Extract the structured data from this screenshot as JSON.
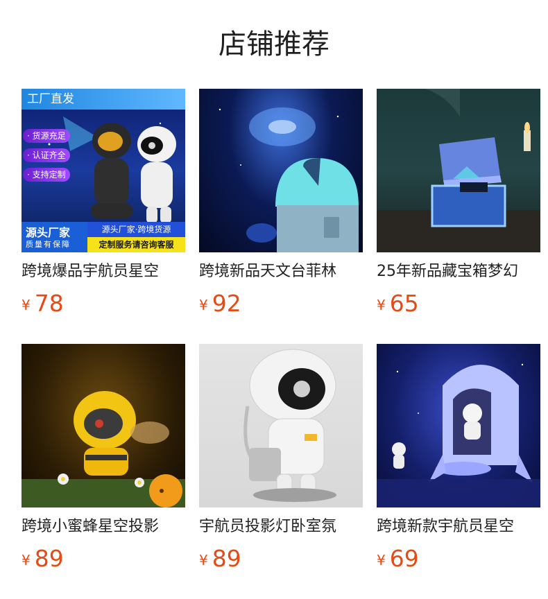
{
  "section": {
    "title": "店铺推荐"
  },
  "products": [
    {
      "name": "跨境爆品宇航员星空",
      "currency": "¥",
      "price": "78",
      "image_overlay": {
        "badge": "工厂直发",
        "tags": [
          "· 货源充足",
          "· 认证齐全",
          "· 支持定制"
        ],
        "bottom_left_title": "源头厂家",
        "bottom_left_sub": "质量有保障",
        "bottom_right_line1": "源头厂家·跨境货源",
        "bottom_right_line2": "定制服务请咨询客服"
      }
    },
    {
      "name": "跨境新品天文台菲林",
      "currency": "¥",
      "price": "92"
    },
    {
      "name": "25年新品藏宝箱梦幻",
      "currency": "¥",
      "price": "65"
    },
    {
      "name": "跨境小蜜蜂星空投影",
      "currency": "¥",
      "price": "89"
    },
    {
      "name": "宇航员投影灯卧室氛",
      "currency": "¥",
      "price": "89"
    },
    {
      "name": "跨境新款宇航员星空",
      "currency": "¥",
      "price": "69"
    }
  ]
}
